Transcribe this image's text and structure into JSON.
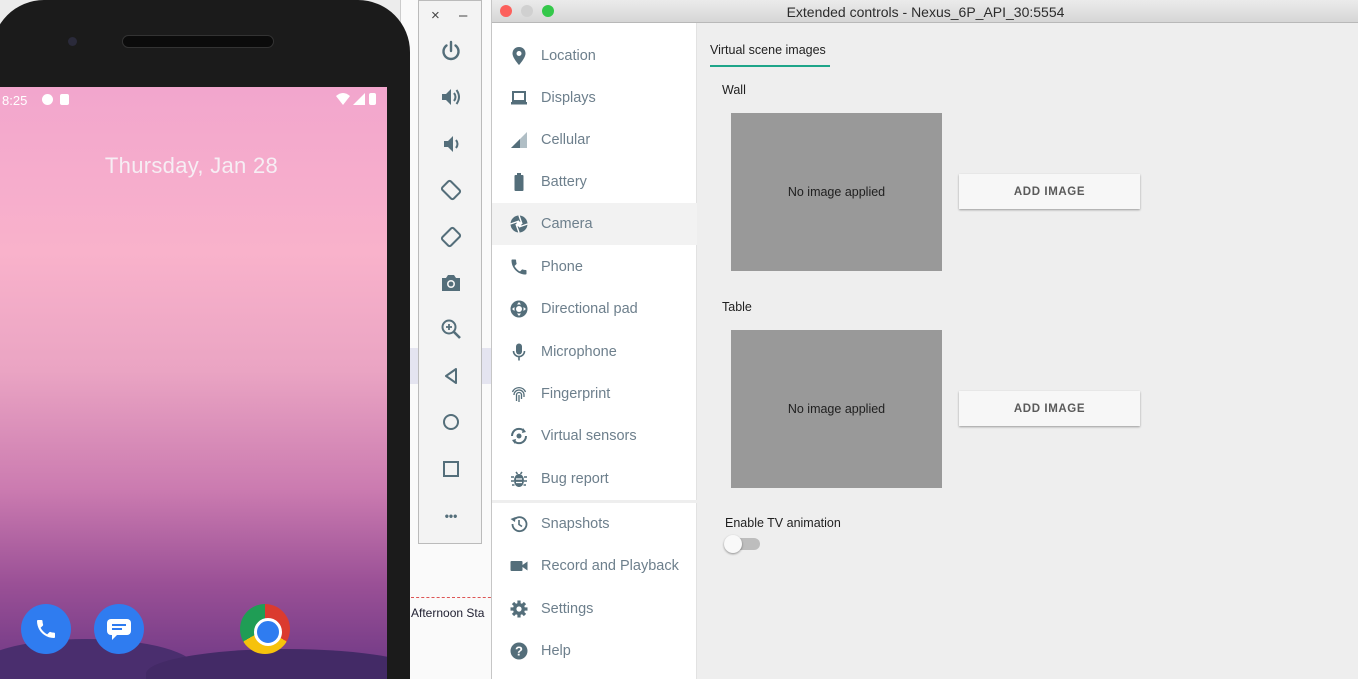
{
  "phone": {
    "status_time": "8:25",
    "date": "Thursday, Jan 28"
  },
  "background_app": {
    "fragments": [
      "Afternoon Sta"
    ]
  },
  "window": {
    "title": "Extended controls - Nexus_6P_API_30:5554"
  },
  "toolbar": {
    "close": "×",
    "minimize": "–",
    "more": "•••"
  },
  "sidebar": {
    "items": [
      {
        "label": "Location",
        "icon": "location-pin-icon"
      },
      {
        "label": "Displays",
        "icon": "laptop-icon"
      },
      {
        "label": "Cellular",
        "icon": "signal-icon"
      },
      {
        "label": "Battery",
        "icon": "battery-icon"
      },
      {
        "label": "Camera",
        "icon": "aperture-icon"
      },
      {
        "label": "Phone",
        "icon": "phone-icon"
      },
      {
        "label": "Directional pad",
        "icon": "dpad-icon"
      },
      {
        "label": "Microphone",
        "icon": "microphone-icon"
      },
      {
        "label": "Fingerprint",
        "icon": "fingerprint-icon"
      },
      {
        "label": "Virtual sensors",
        "icon": "rotate-icon"
      },
      {
        "label": "Bug report",
        "icon": "bug-icon"
      },
      {
        "label": "Snapshots",
        "icon": "history-icon"
      },
      {
        "label": "Record and Playback",
        "icon": "video-camera-icon"
      },
      {
        "label": "Settings",
        "icon": "gear-icon"
      },
      {
        "label": "Help",
        "icon": "help-icon"
      }
    ],
    "selected": "Camera"
  },
  "content": {
    "tab": "Virtual scene images",
    "wall_label": "Wall",
    "wall_placeholder": "No image applied",
    "wall_button": "ADD IMAGE",
    "table_label": "Table",
    "table_placeholder": "No image applied",
    "table_button": "ADD IMAGE",
    "tv_label": "Enable TV animation",
    "tv_enabled": false
  },
  "colors": {
    "accent": "#1ea589",
    "nav_text": "#6d7f8c",
    "nav_icon": "#546e7a",
    "image_placeholder": "#999999",
    "close_light": "#fc605c",
    "min_light": "#d0d0d0",
    "zoom_light": "#34c84a"
  }
}
